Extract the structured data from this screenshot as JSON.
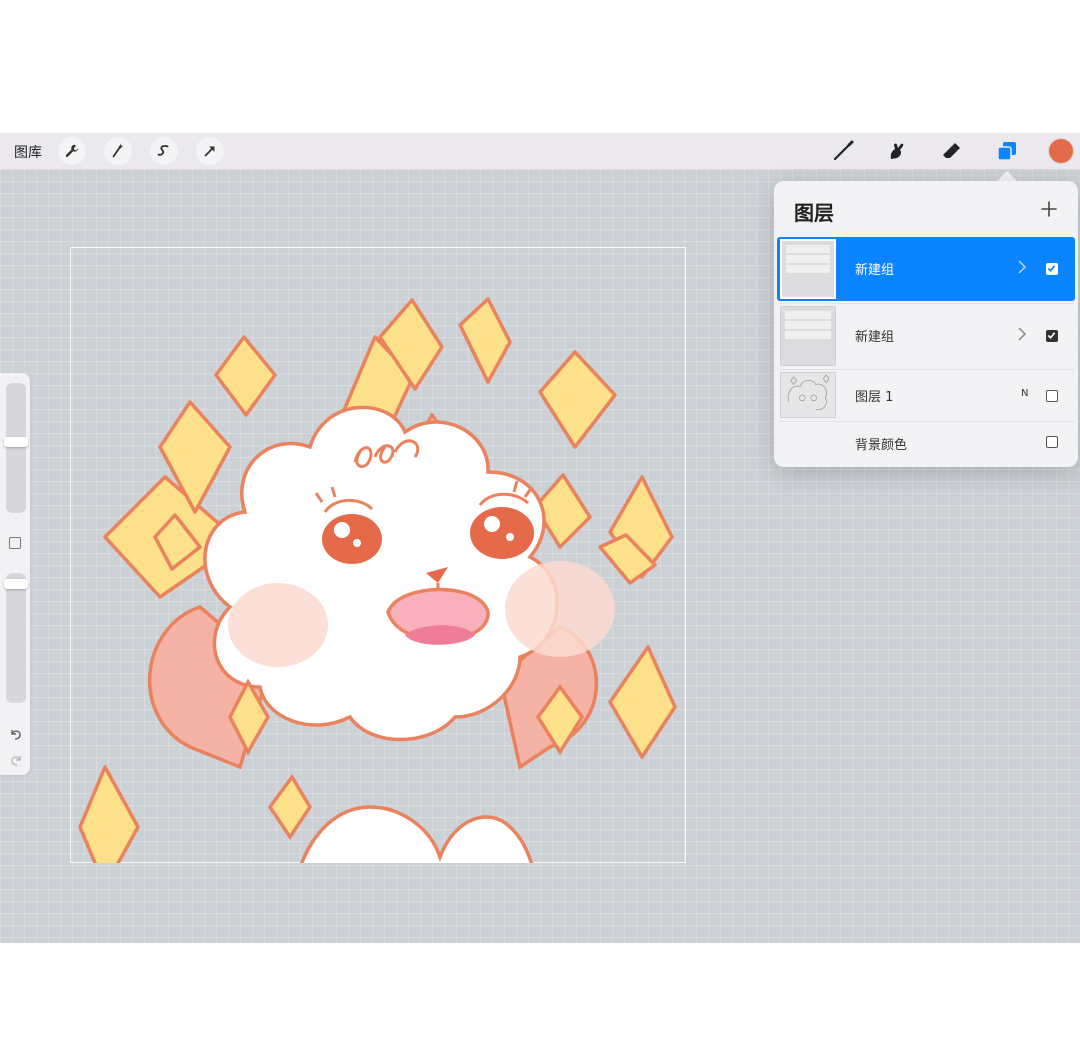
{
  "topbar": {
    "gallery_label": "图库",
    "left_tools": [
      "wrench-icon",
      "magic-wand-icon",
      "selection-icon",
      "transform-arrow-icon"
    ],
    "right_tools": [
      "brush-icon",
      "smudge-icon",
      "eraser-icon",
      "layers-icon"
    ],
    "current_color": "#e56a4a"
  },
  "layers_panel": {
    "title": "图层",
    "add_label": "+",
    "layers": [
      {
        "name": "新建组",
        "type": "group",
        "visible": true,
        "selected": true
      },
      {
        "name": "新建组",
        "type": "group",
        "visible": true,
        "selected": false
      },
      {
        "name": "图层 1",
        "type": "layer",
        "blend_mode": "N",
        "visible": false,
        "selected": false
      },
      {
        "name": "背景颜色",
        "type": "background",
        "visible": false,
        "selected": false
      }
    ]
  },
  "colors": {
    "accent": "#0a84ff",
    "canvas_bg": "#ccd1d6",
    "outline": "#e9825d",
    "sparkle": "#fde08a",
    "blush": "#fcd9d0"
  }
}
